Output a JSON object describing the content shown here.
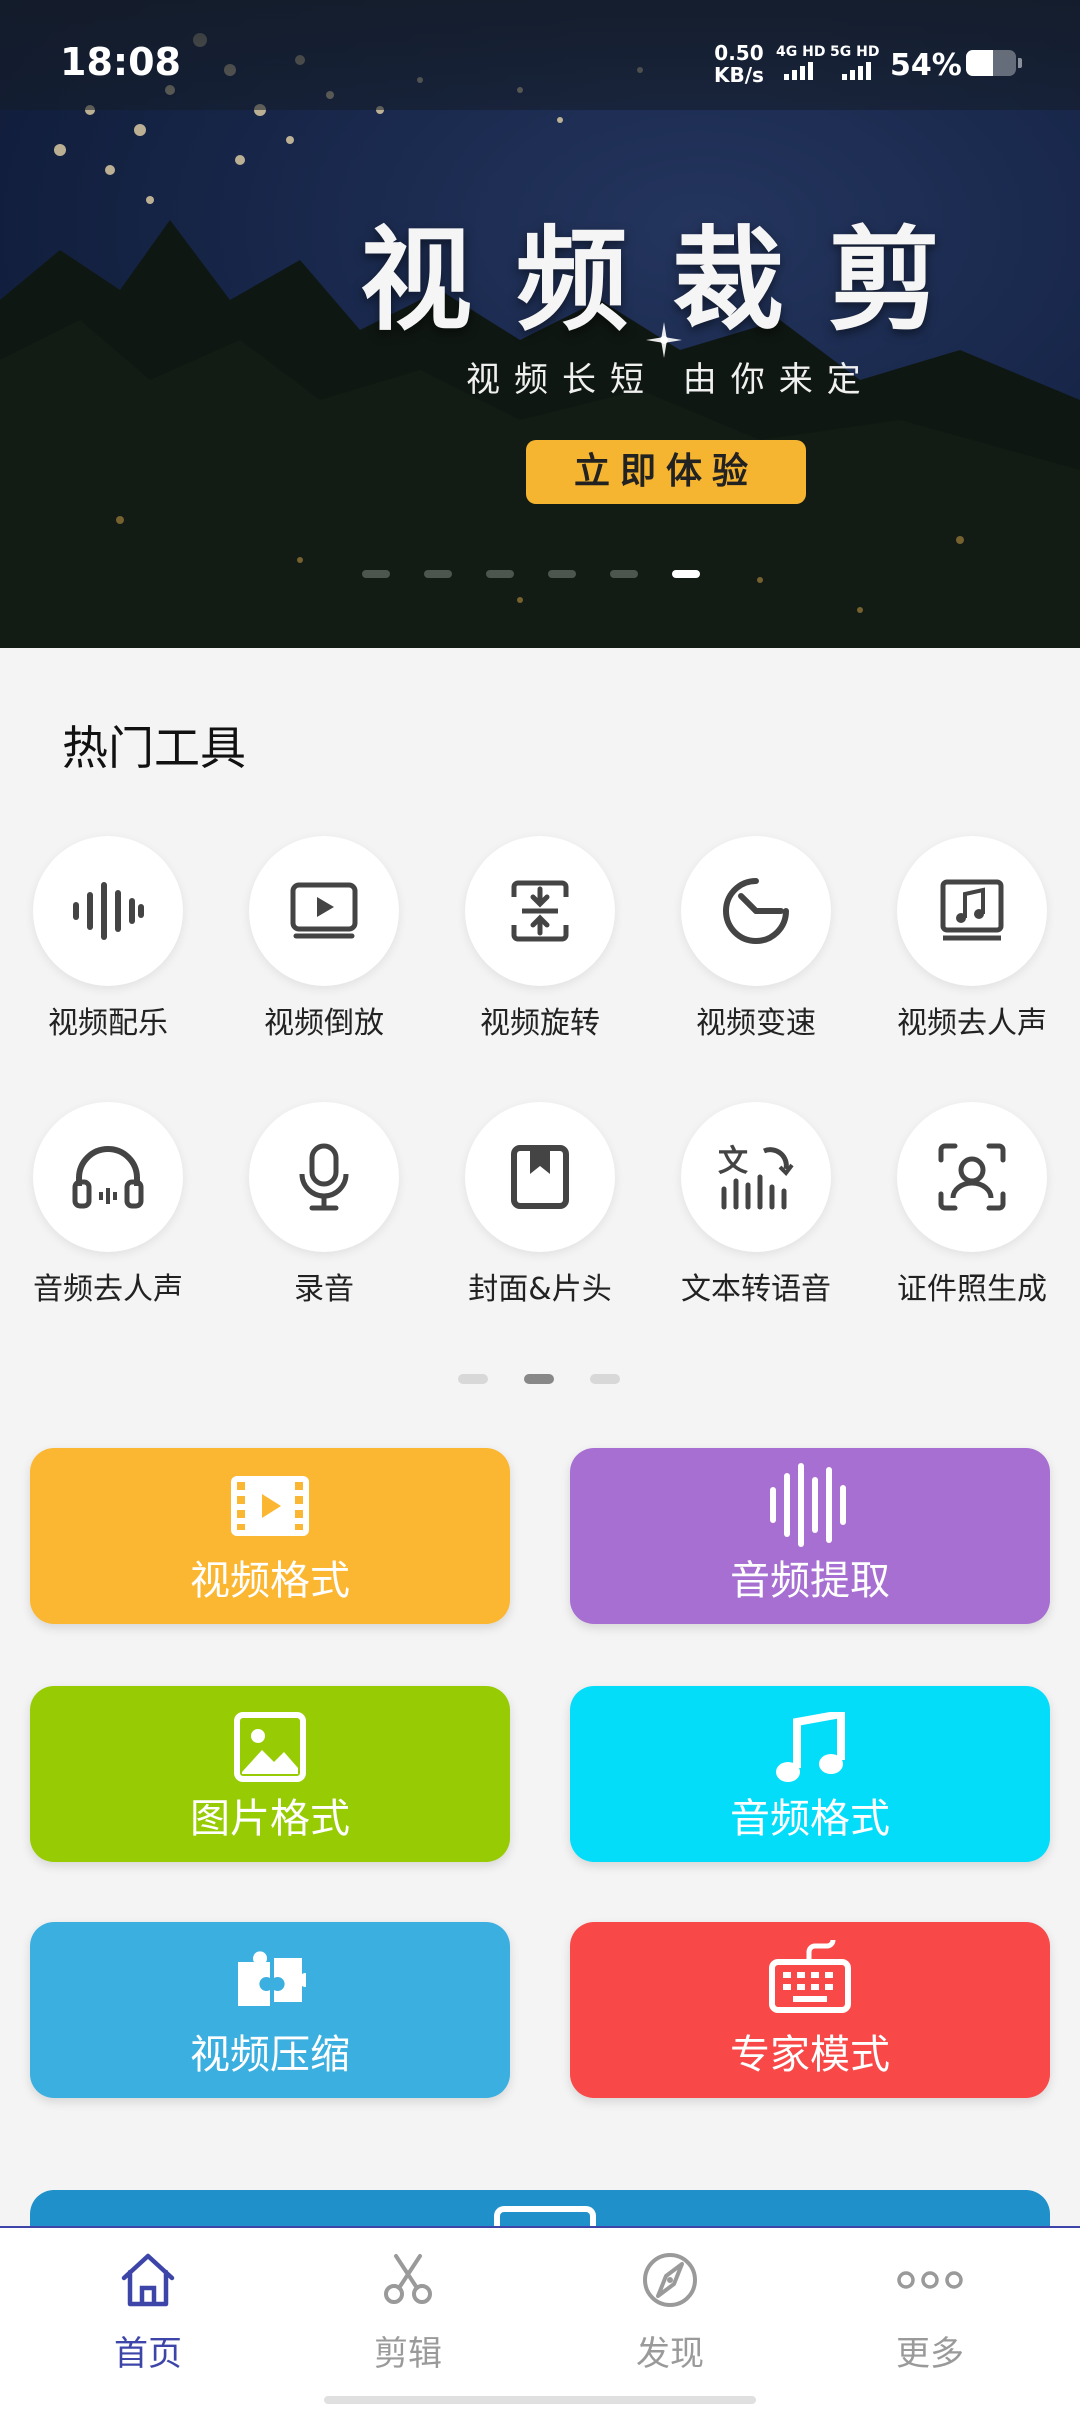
{
  "status": {
    "time": "18:08",
    "speed_value": "0.50",
    "speed_unit": "KB/s",
    "sim1": "4G HD",
    "sim2": "5G HD",
    "battery_text": "54%",
    "battery_level": 0.54
  },
  "banner": {
    "title": "视频裁剪",
    "subtitle": "视频长短 由你来定",
    "button": "立即体验",
    "slide_count": 6,
    "active_slide": 6
  },
  "hot_tools": {
    "title": "热门工具",
    "items": [
      {
        "label": "视频配乐",
        "icon": "sound-wave-icon"
      },
      {
        "label": "视频倒放",
        "icon": "video-play-icon"
      },
      {
        "label": "视频旋转",
        "icon": "rotate-compress-icon"
      },
      {
        "label": "视频变速",
        "icon": "speed-gauge-icon"
      },
      {
        "label": "视频去人声",
        "icon": "music-note-icon"
      },
      {
        "label": "音频去人声",
        "icon": "headphones-icon"
      },
      {
        "label": "录音",
        "icon": "microphone-icon"
      },
      {
        "label": "封面&片头",
        "icon": "bookmark-icon"
      },
      {
        "label": "文本转语音",
        "icon": "text-to-speech-icon"
      },
      {
        "label": "证件照生成",
        "icon": "portrait-scan-icon"
      }
    ],
    "page_count": 3,
    "active_page": 2
  },
  "cards": [
    {
      "label": "视频格式",
      "color": "#fbb731",
      "icon": "film-icon"
    },
    {
      "label": "音频提取",
      "color": "#a66fd1",
      "icon": "audio-bars-icon"
    },
    {
      "label": "图片格式",
      "color": "#97cc05",
      "icon": "image-icon"
    },
    {
      "label": "音频格式",
      "color": "#03ddfa",
      "icon": "music-note-icon"
    },
    {
      "label": "视频压缩",
      "color": "#3bafe0",
      "icon": "puzzle-icon"
    },
    {
      "label": "专家模式",
      "color": "#f84848",
      "icon": "keyboard-icon"
    }
  ],
  "tabbar": {
    "items": [
      {
        "label": "首页",
        "icon": "home-icon"
      },
      {
        "label": "剪辑",
        "icon": "scissors-icon"
      },
      {
        "label": "发现",
        "icon": "compass-icon"
      },
      {
        "label": "更多",
        "icon": "more-icon"
      }
    ],
    "active": 0,
    "active_color": "#3d46a8"
  }
}
